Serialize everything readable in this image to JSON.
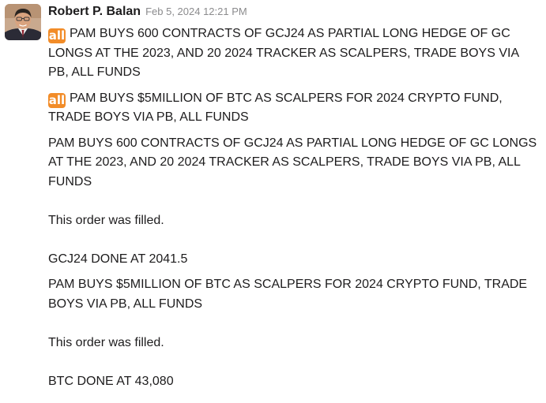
{
  "message": {
    "sender": "Robert P. Balan",
    "timestamp": "Feb 5, 2024 12:21 PM",
    "badge": "all",
    "badge_color": "#f28c28",
    "paragraphs": [
      "PAM BUYS 600 CONTRACTS OF GCJ24 AS PARTIAL LONG HEDGE OF GC LONGS AT THE 2023, AND 20 2024 TRACKER AS SCALPERS, TRADE BOYS VIA PB, ALL FUNDS",
      "PAM BUYS $5MILLION OF BTC AS SCALPERS FOR 2024 CRYPTO FUND, TRADE BOYS VIA PB, ALL FUNDS",
      "PAM BUYS 600 CONTRACTS OF GCJ24 AS PARTIAL LONG HEDGE OF GC LONGS AT THE 2023, AND 20 2024 TRACKER AS SCALPERS, TRADE BOYS VIA PB, ALL FUNDS",
      "This order was filled.",
      "GCJ24 DONE AT 2041.5",
      "PAM BUYS $5MILLION OF BTC AS SCALPERS FOR 2024 CRYPTO FUND, TRADE BOYS VIA PB, ALL FUNDS",
      "This order was filled.",
      "BTC DONE AT 43,080"
    ]
  }
}
